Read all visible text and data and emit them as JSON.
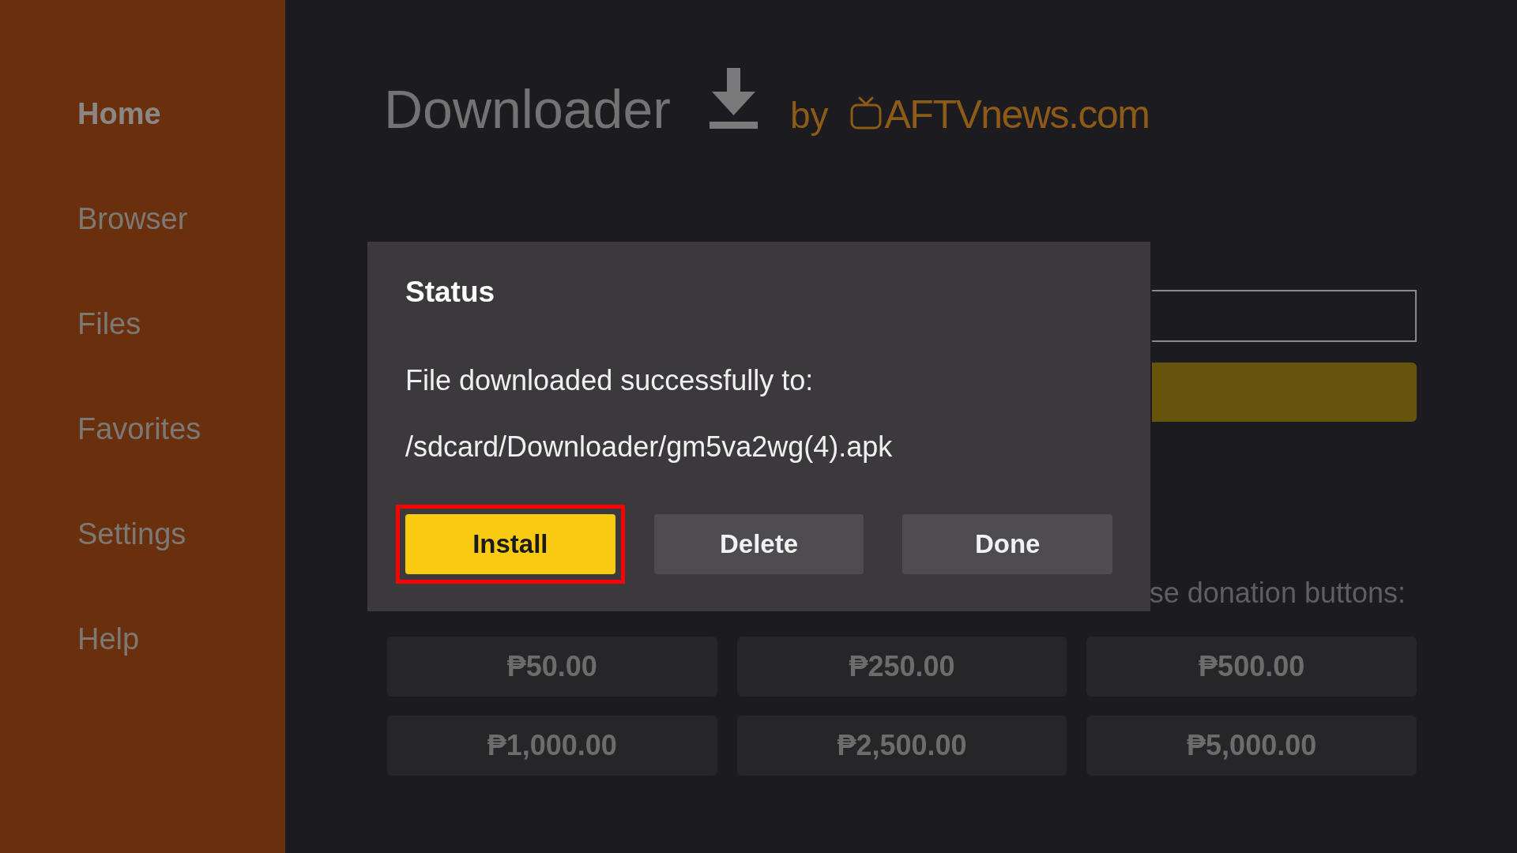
{
  "sidebar": {
    "items": [
      {
        "label": "Home",
        "selected": true
      },
      {
        "label": "Browser",
        "selected": false
      },
      {
        "label": "Files",
        "selected": false
      },
      {
        "label": "Favorites",
        "selected": false
      },
      {
        "label": "Settings",
        "selected": false
      },
      {
        "label": "Help",
        "selected": false
      }
    ]
  },
  "header": {
    "title": "Downloader",
    "byline": "by",
    "brand": "AFTVnews.com"
  },
  "donation_prompt": "se donation buttons:",
  "donation_buttons": [
    "₱50.00",
    "₱250.00",
    "₱500.00",
    "₱1,000.00",
    "₱2,500.00",
    "₱5,000.00"
  ],
  "dialog": {
    "title": "Status",
    "message": "File downloaded successfully to:",
    "path": "/sdcard/Downloader/gm5va2wg(4).apk",
    "buttons": [
      {
        "label": "Install",
        "focused": true,
        "highlighted": true
      },
      {
        "label": "Delete",
        "focused": false,
        "highlighted": false
      },
      {
        "label": "Done",
        "focused": false,
        "highlighted": false
      }
    ]
  }
}
